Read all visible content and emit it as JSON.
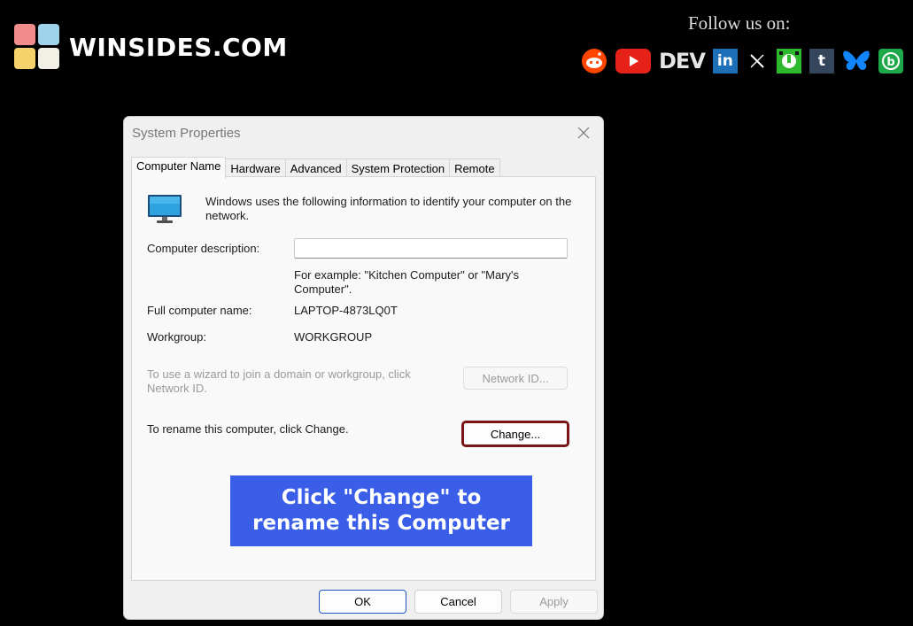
{
  "branding": {
    "logo_text": "WINSIDES.COM",
    "logo_colors": [
      "#f08c8c",
      "#9fd3ec",
      "#f5d36a",
      "#f1efe6"
    ],
    "follow_label": "Follow us on:",
    "social_icons": [
      {
        "name": "reddit-icon",
        "color": "#ff4500"
      },
      {
        "name": "youtube-icon",
        "color": "#e62117"
      },
      {
        "name": "dev-icon",
        "label": "DEV"
      },
      {
        "name": "linkedin-icon",
        "label": "in",
        "color": "#1d6fb8"
      },
      {
        "name": "x-icon",
        "label": "𝕏"
      },
      {
        "name": "mastodon-icon",
        "color": "#2eb82e"
      },
      {
        "name": "tumblr-icon",
        "label": "t",
        "color": "#35465c"
      },
      {
        "name": "bluesky-icon",
        "color": "#1185fe"
      },
      {
        "name": "bsky-b-icon",
        "color": "#1da84a"
      }
    ]
  },
  "dialog": {
    "title": "System Properties",
    "tabs": [
      {
        "label": "Computer Name",
        "active": true
      },
      {
        "label": "Hardware"
      },
      {
        "label": "Advanced"
      },
      {
        "label": "System Protection"
      },
      {
        "label": "Remote"
      }
    ],
    "intro_text": "Windows uses the following information to identify your computer on the network.",
    "description_label": "Computer description:",
    "description_value": "",
    "example_text": "For example: \"Kitchen Computer\" or \"Mary's Computer\".",
    "full_name_label": "Full computer name:",
    "full_name_value": "LAPTOP-4873LQ0T",
    "workgroup_label": "Workgroup:",
    "workgroup_value": "WORKGROUP",
    "wizard_text": "To use a wizard to join a domain or workgroup, click Network ID.",
    "network_id_label": "Network ID...",
    "rename_text": "To rename this computer, click Change.",
    "change_label": "Change...",
    "ok_label": "OK",
    "cancel_label": "Cancel",
    "apply_label": "Apply"
  },
  "callout": {
    "text": "Click \"Change\" to rename this Computer",
    "color": "#3a5ee8"
  }
}
